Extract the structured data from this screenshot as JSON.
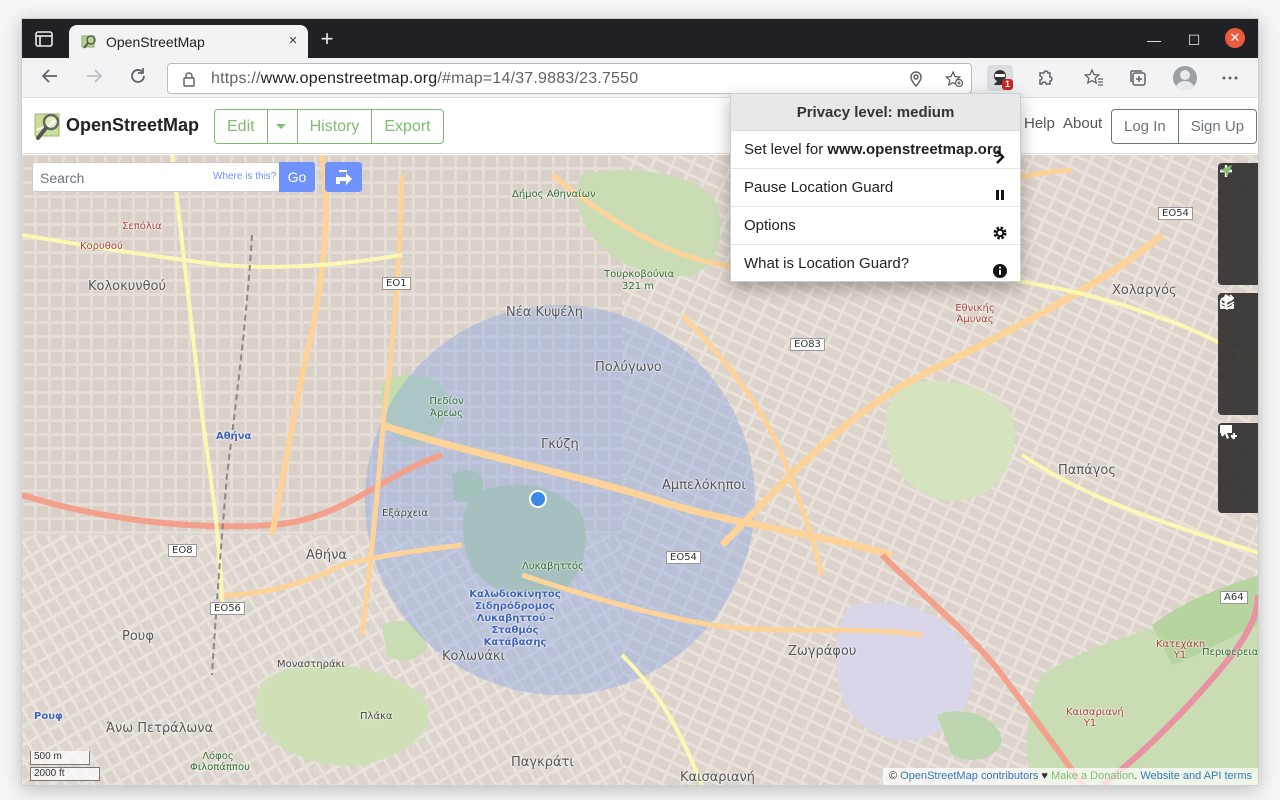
{
  "browser": {
    "tab_title": "OpenStreetMap",
    "tab_close": "×",
    "new_tab": "+",
    "url_prefix": "https://",
    "url_domain": "www.openstreetmap.org",
    "url_path": "/#map=14/37.9883/23.7550",
    "extension_badge": "1",
    "window_min": "—",
    "window_max": "☐",
    "window_close": "✕"
  },
  "osm": {
    "site_name": "OpenStreetMap",
    "edit": "Edit",
    "history": "History",
    "export": "Export",
    "help": "Help",
    "about": "About",
    "login": "Log In",
    "signup": "Sign Up",
    "search_placeholder": "Search",
    "where_is_this": "Where is this?",
    "go": "Go"
  },
  "popup": {
    "title": "Privacy level: medium",
    "set_level_prefix": "Set level for ",
    "set_level_domain": "www.openstreetmap.org",
    "pause": "Pause Location Guard",
    "options": "Options",
    "what_is": "What is Location Guard?"
  },
  "map": {
    "labels": {
      "nea_kypseli": "Νέα Κυψέλη",
      "polygono": "Πολύγωνο",
      "gkyzi": "Γκύζη",
      "ampelokipoi": "Αμπελόκηποι",
      "exarcheia": "Εξάρχεια",
      "athina": "Αθήνα",
      "kolonaki": "Κολωνάκι",
      "rouf": "Ρουφ",
      "monastiraki": "Μοναστηράκι",
      "plaka": "Πλάκα",
      "ano_petralona": "Άνω Πετράλωνα",
      "pagkrati": "Παγκράτι",
      "kaisariani": "Καισαριανή",
      "zografou": "Ζωγράφου",
      "papagos": "Παπάγος",
      "cholargos": "Χολαργός",
      "kolokynthou": "Κολοκυνθού",
      "tourkovounia": "Τουρκοβούνια",
      "tourkovounia_height": "321 m",
      "likavittos": "Λυκαβηττός",
      "pedion_areos": "Πεδίον Άρεως",
      "station": "Καλωδιοκίνητος Σιδηρόδρομος Λυκαβηττού - Σταθμός Κατάβασης",
      "ethnikis_amynas": "Εθνικής Άμυνας",
      "athina_station": "Αθήνα",
      "rouf_station": "Ρουφ",
      "kaisariani_y1": "Καισαριανή Υ1",
      "katechaki_y1": "Κατεχάκη Υ1",
      "sepolia": "Σεπόλια",
      "korythou": "Κορυθού",
      "periferiaki": "Περιφερειακ",
      "dimos_athinaion": "Δήμος Αθηναίων",
      "lofos_filopappou": "Λόφος Φιλοπάππου"
    },
    "roads": {
      "eo1": "ΕΟ1",
      "eo8": "ΕΟ8",
      "eo54_a": "ΕΟ54",
      "eo54_b": "ΕΟ54",
      "eo56": "ΕΟ56",
      "eo83": "ΕΟ83",
      "a64": "Α64"
    },
    "scale_m": "500 m",
    "scale_ft": "2000 ft",
    "attribution_prefix": "© ",
    "attribution_link": "OpenStreetMap contributors",
    "attribution_heart": " ♥ ",
    "attribution_donate": "Make a Donation",
    "attribution_sep": ". ",
    "attribution_terms": "Website and API terms"
  },
  "icons": {
    "zoom_in": "zoom-in-icon",
    "zoom_out": "zoom-out-icon",
    "locate": "locate-icon",
    "layers": "layers-icon",
    "info": "info-icon",
    "share": "share-icon",
    "note": "add-note-icon",
    "query": "query-features-icon"
  },
  "colors": {
    "osm_green": "#7ebc6f",
    "osm_blue": "#7092ff",
    "privacy_circle": "#8aa7e8",
    "location_dot": "#3d8ae6"
  }
}
